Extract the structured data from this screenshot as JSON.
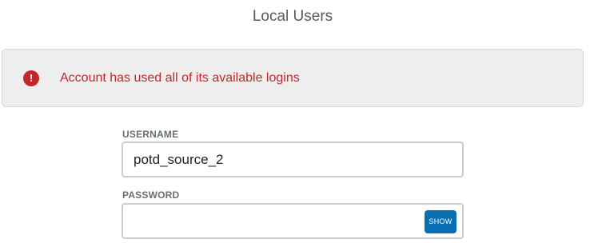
{
  "header": {
    "title": "Local Users"
  },
  "alert": {
    "icon": "exclamation-circle-icon",
    "icon_glyph": "!",
    "message": "Account has used all of its available logins",
    "color": "#c1272d"
  },
  "form": {
    "username": {
      "label": "USERNAME",
      "value": "potd_source_2"
    },
    "password": {
      "label": "PASSWORD",
      "value": "",
      "show_label": "SHOW"
    }
  },
  "colors": {
    "accent": "#0a6fb0",
    "error": "#c1272d"
  }
}
